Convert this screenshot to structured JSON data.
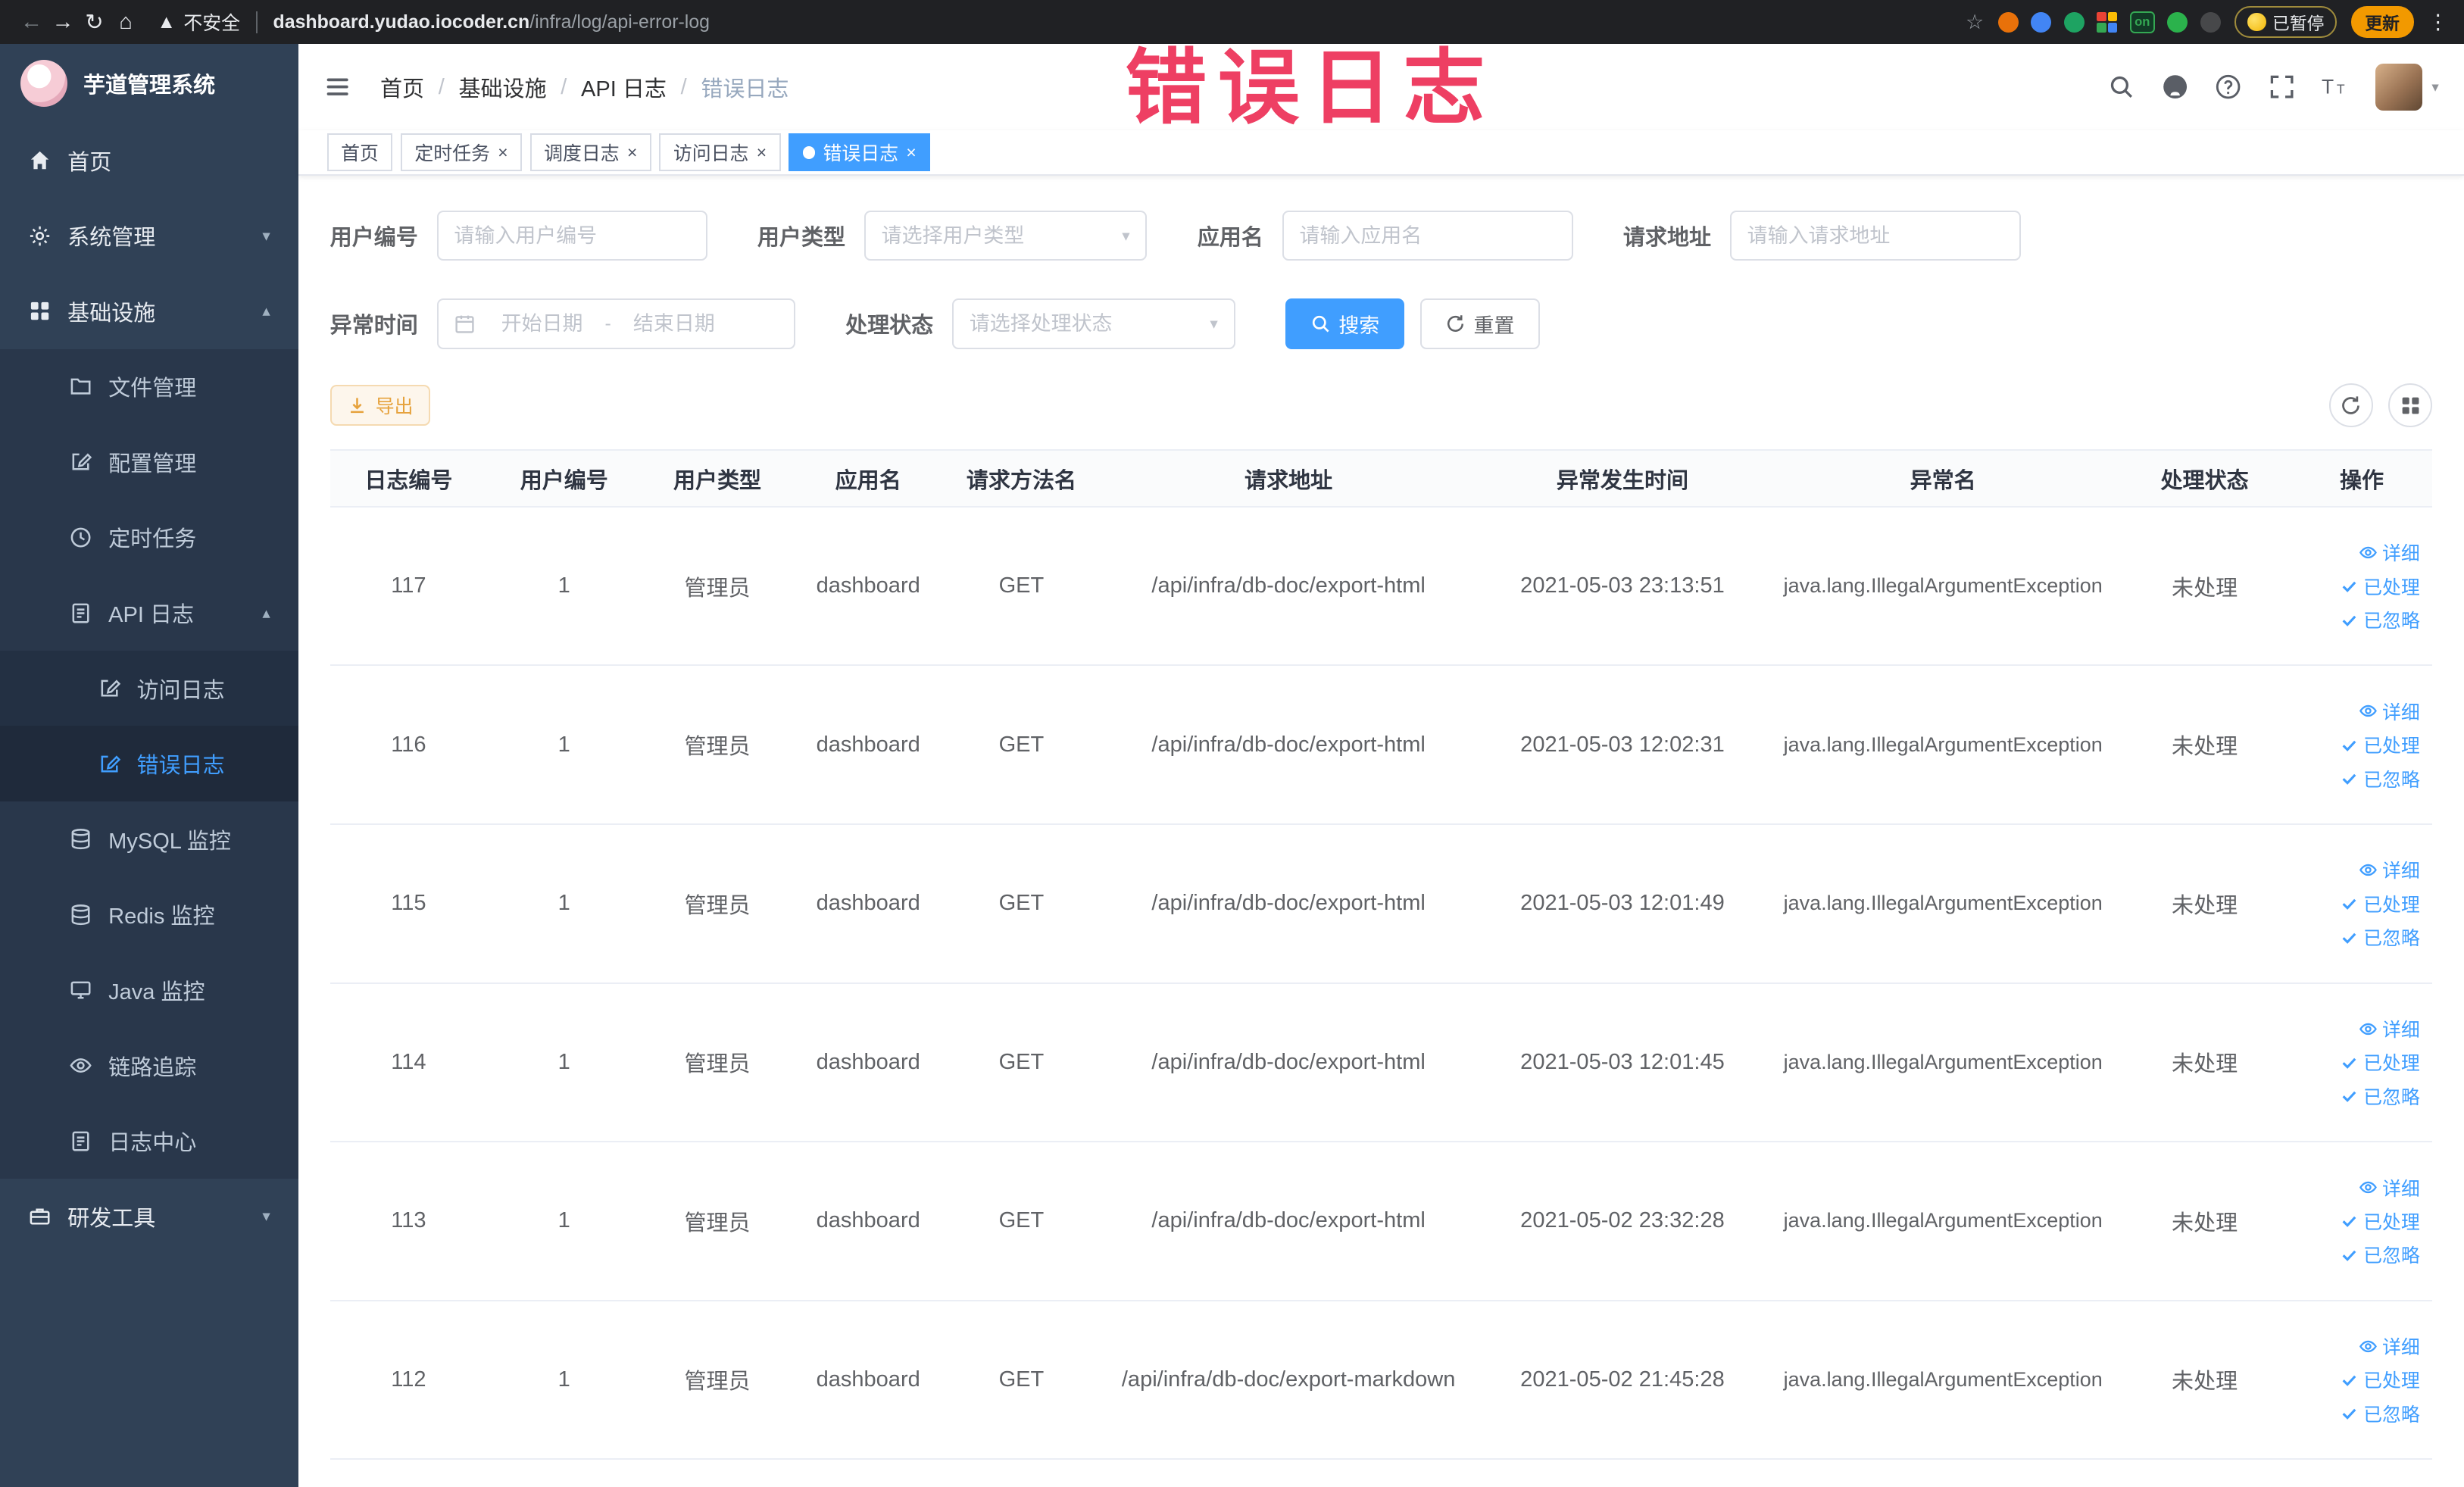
{
  "overlay": {
    "text": "错误日志",
    "color": "#ee3f63"
  },
  "browser": {
    "security_label": "不安全",
    "url_domain": "dashboard.yudao.iocoder.cn",
    "url_path": "/infra/log/api-error-log",
    "extensions": [
      {
        "name": "extension-orange-icon",
        "color": "#e8710a"
      },
      {
        "name": "extension-blue-icon",
        "color": "#4285f4"
      },
      {
        "name": "extension-green-icon",
        "color": "#1ea362"
      },
      {
        "name": "apps-grid-icon"
      },
      {
        "name": "on-badge-icon",
        "label": "on",
        "color": "#34a853"
      },
      {
        "name": "extension-leaf-icon",
        "color": "#2bb24c"
      },
      {
        "name": "extension-paw-icon",
        "color": "#47484a"
      }
    ],
    "paused_badge": "已暂停",
    "update_button": "更新"
  },
  "sidebar": {
    "logo_title": "芋道管理系统",
    "items": [
      {
        "id": "home",
        "label": "首页",
        "icon": "home-icon",
        "level": 0
      },
      {
        "id": "system-management",
        "label": "系统管理",
        "icon": "gear-icon",
        "level": 0,
        "chevron": "down"
      },
      {
        "id": "infrastructure",
        "label": "基础设施",
        "icon": "grid-icon",
        "level": 0,
        "chevron": "up"
      },
      {
        "id": "file-management",
        "label": "文件管理",
        "icon": "folder-icon",
        "level": 1
      },
      {
        "id": "config-management",
        "label": "配置管理",
        "icon": "edit-icon",
        "level": 1
      },
      {
        "id": "scheduled-tasks",
        "label": "定时任务",
        "icon": "clock-icon",
        "level": 1
      },
      {
        "id": "api-log",
        "label": "API 日志",
        "icon": "doc-icon",
        "level": 1,
        "chevron": "up"
      },
      {
        "id": "access-log",
        "label": "访问日志",
        "icon": "edit-icon",
        "level": 2
      },
      {
        "id": "error-log",
        "label": "错误日志",
        "icon": "edit-icon",
        "level": 2,
        "active": true
      },
      {
        "id": "mysql-monitor",
        "label": "MySQL 监控",
        "icon": "db-icon",
        "level": 1
      },
      {
        "id": "redis-monitor",
        "label": "Redis 监控",
        "icon": "db-icon",
        "level": 1
      },
      {
        "id": "java-monitor",
        "label": "Java 监控",
        "icon": "monitor-icon",
        "level": 1
      },
      {
        "id": "trace",
        "label": "链路追踪",
        "icon": "eye-icon",
        "level": 1
      },
      {
        "id": "log-center",
        "label": "日志中心",
        "icon": "doc-icon",
        "level": 1
      },
      {
        "id": "dev-tools",
        "label": "研发工具",
        "icon": "toolbox-icon",
        "level": 0,
        "chevron": "down"
      }
    ]
  },
  "header": {
    "tools": [
      "search-icon",
      "github-icon",
      "help-icon",
      "fullscreen-icon",
      "font-size-icon"
    ]
  },
  "breadcrumb": [
    "首页",
    "基础设施",
    "API 日志",
    "错误日志"
  ],
  "tabs": [
    {
      "id": "home",
      "label": "首页",
      "closable": false,
      "active": false
    },
    {
      "id": "scheduled-tasks",
      "label": "定时任务",
      "closable": true,
      "active": false
    },
    {
      "id": "schedule-log",
      "label": "调度日志",
      "closable": true,
      "active": false
    },
    {
      "id": "access-log",
      "label": "访问日志",
      "closable": true,
      "active": false
    },
    {
      "id": "error-log",
      "label": "错误日志",
      "closable": true,
      "active": true
    }
  ],
  "filters": {
    "user_id": {
      "label": "用户编号",
      "placeholder": "请输入用户编号"
    },
    "user_type": {
      "label": "用户类型",
      "placeholder": "请选择用户类型"
    },
    "app_name": {
      "label": "应用名",
      "placeholder": "请输入应用名"
    },
    "request_url": {
      "label": "请求地址",
      "placeholder": "请输入请求地址"
    },
    "exception_time": {
      "label": "异常时间",
      "start_placeholder": "开始日期",
      "separator": "-",
      "end_placeholder": "结束日期"
    },
    "process_status": {
      "label": "处理状态",
      "placeholder": "请选择处理状态"
    },
    "search_button": "搜索",
    "reset_button": "重置"
  },
  "toolbar": {
    "export_button": "导出"
  },
  "table": {
    "columns": [
      "日志编号",
      "用户编号",
      "用户类型",
      "应用名",
      "请求方法名",
      "请求地址",
      "异常发生时间",
      "异常名",
      "处理状态",
      "操作"
    ],
    "actions": [
      {
        "label": "详细",
        "icon": "view-eye-icon"
      },
      {
        "label": "已处理",
        "icon": "check-icon"
      },
      {
        "label": "已忽略",
        "icon": "check-icon"
      }
    ],
    "rows": [
      {
        "id": "117",
        "user_id": "1",
        "user_type": "管理员",
        "app": "dashboard",
        "method": "GET",
        "url": "/api/infra/db-doc/export-html",
        "time": "2021-05-03 23:13:51",
        "exception": "java.lang.IllegalArgumentException",
        "status": "未处理"
      },
      {
        "id": "116",
        "user_id": "1",
        "user_type": "管理员",
        "app": "dashboard",
        "method": "GET",
        "url": "/api/infra/db-doc/export-html",
        "time": "2021-05-03 12:02:31",
        "exception": "java.lang.IllegalArgumentException",
        "status": "未处理"
      },
      {
        "id": "115",
        "user_id": "1",
        "user_type": "管理员",
        "app": "dashboard",
        "method": "GET",
        "url": "/api/infra/db-doc/export-html",
        "time": "2021-05-03 12:01:49",
        "exception": "java.lang.IllegalArgumentException",
        "status": "未处理"
      },
      {
        "id": "114",
        "user_id": "1",
        "user_type": "管理员",
        "app": "dashboard",
        "method": "GET",
        "url": "/api/infra/db-doc/export-html",
        "time": "2021-05-03 12:01:45",
        "exception": "java.lang.IllegalArgumentException",
        "status": "未处理"
      },
      {
        "id": "113",
        "user_id": "1",
        "user_type": "管理员",
        "app": "dashboard",
        "method": "GET",
        "url": "/api/infra/db-doc/export-html",
        "time": "2021-05-02 23:32:28",
        "exception": "java.lang.IllegalArgumentException",
        "status": "未处理"
      },
      {
        "id": "112",
        "user_id": "1",
        "user_type": "管理员",
        "app": "dashboard",
        "method": "GET",
        "url": "/api/infra/db-doc/export-markdown",
        "time": "2021-05-02 21:45:28",
        "exception": "java.lang.IllegalArgumentException",
        "status": "未处理"
      }
    ]
  },
  "colors": {
    "primary": "#409eff",
    "sidebar_bg": "#304156",
    "warning": "#e6a23c"
  }
}
